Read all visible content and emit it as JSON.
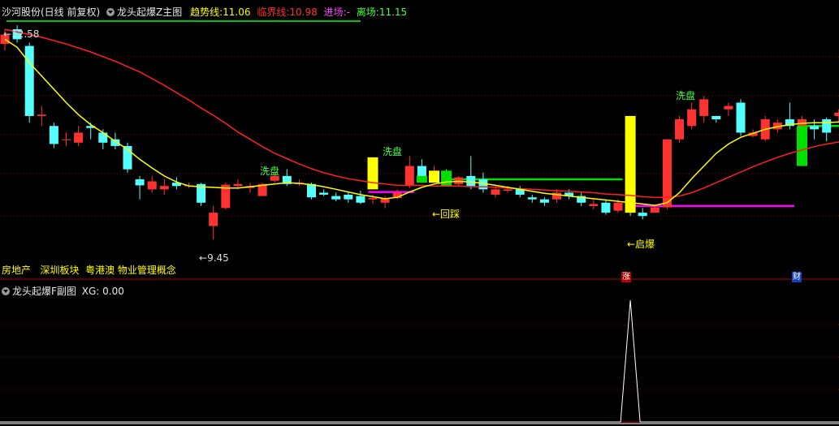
{
  "header": {
    "stock_title": "沙河股份(日线 前复权)",
    "indicator_name": "龙头起爆Z主图",
    "trend_label": "趋势线:",
    "trend_value": "11.06",
    "critical_label": "临界线:",
    "critical_value": "10.98",
    "entry_label": "进场:",
    "entry_value": "-",
    "exit_label": "离场:",
    "exit_value": "11.15"
  },
  "concepts": "房地产   深圳板块  粤港澳 物业管理概念",
  "annotations": {
    "high_price": "12.58",
    "low_price": "9.45",
    "wash1": "洗盘",
    "wash2": "洗盘",
    "wash3": "洗盘",
    "pullback": "←回踩",
    "burst": "←启爆"
  },
  "markers": {
    "limit_up": "涨",
    "finance": "财"
  },
  "sub_header": {
    "name": "龙头起爆F副图",
    "xg_label": "XG:",
    "xg_value": "0.00"
  },
  "colors": {
    "up": "#ff3232",
    "down": "#54ffff",
    "trend": "#ffff00",
    "critical": "#ff2020",
    "signal_yellow": "#ffff00",
    "signal_green": "#00e000",
    "magenta": "#ff00ff",
    "grid": "#8a0000"
  },
  "chart_data": {
    "type": "candlestick",
    "candles": [
      [
        12.38,
        12.52,
        12.6,
        12.28
      ],
      [
        12.6,
        12.45,
        12.66,
        12.4
      ],
      [
        12.35,
        11.3,
        12.4,
        11.2
      ],
      [
        11.3,
        11.32,
        11.45,
        11.15
      ],
      [
        11.15,
        10.88,
        11.2,
        10.82
      ],
      [
        10.95,
        10.95,
        11.05,
        10.85
      ],
      [
        10.9,
        11.05,
        11.15,
        10.85
      ],
      [
        11.15,
        11.12,
        11.2,
        10.95
      ],
      [
        11.05,
        10.9,
        11.1,
        10.8
      ],
      [
        10.95,
        10.85,
        11.05,
        10.8
      ],
      [
        10.85,
        10.5,
        10.9,
        10.45
      ],
      [
        10.35,
        10.26,
        10.4,
        10.05
      ],
      [
        10.2,
        10.32,
        10.4,
        10.15
      ],
      [
        10.2,
        10.25,
        10.35,
        10.12
      ],
      [
        10.3,
        10.25,
        10.38,
        10.2
      ],
      [
        10.25,
        10.26,
        10.3,
        10.22
      ],
      [
        10.28,
        10.0,
        10.3,
        9.95
      ],
      [
        9.65,
        9.85,
        9.95,
        9.45
      ],
      [
        9.92,
        10.27,
        10.3,
        9.9
      ],
      [
        10.25,
        10.28,
        10.35,
        10.2
      ],
      [
        10.22,
        10.25,
        10.3,
        10.15
      ],
      [
        10.1,
        10.28,
        10.3,
        10.1
      ],
      [
        10.33,
        10.4,
        10.45,
        10.3
      ],
      [
        10.4,
        10.28,
        10.5,
        10.25
      ],
      [
        10.28,
        10.3,
        10.35,
        10.25
      ],
      [
        10.28,
        10.08,
        10.3,
        10.05
      ],
      [
        10.15,
        10.12,
        10.2,
        10.1
      ],
      [
        10.1,
        10.05,
        10.15,
        10.02
      ],
      [
        10.12,
        10.05,
        10.15,
        10.0
      ],
      [
        10.1,
        10.0,
        10.18,
        9.98
      ],
      [
        10.05,
        10.07,
        10.12,
        9.98
      ],
      [
        10.0,
        10.06,
        10.1,
        9.92
      ],
      [
        10.07,
        10.15,
        10.2,
        10.05
      ],
      [
        10.25,
        10.55,
        10.7,
        10.22
      ],
      [
        10.55,
        10.38,
        10.65,
        10.3
      ],
      [
        10.35,
        10.46,
        10.55,
        10.3
      ],
      [
        10.44,
        10.4,
        10.5,
        10.35
      ],
      [
        10.28,
        10.38,
        10.4,
        10.25
      ],
      [
        10.4,
        10.25,
        10.7,
        10.2
      ],
      [
        10.35,
        10.2,
        10.45,
        10.15
      ],
      [
        10.12,
        10.2,
        10.25,
        10.08
      ],
      [
        10.18,
        10.2,
        10.25,
        10.15
      ],
      [
        10.2,
        10.12,
        10.25,
        10.08
      ],
      [
        10.08,
        10.05,
        10.12,
        10.0
      ],
      [
        10.05,
        10.0,
        10.08,
        9.95
      ],
      [
        10.05,
        10.15,
        10.2,
        10.0
      ],
      [
        10.15,
        10.1,
        10.2,
        10.05
      ],
      [
        10.1,
        10.0,
        10.15,
        9.95
      ],
      [
        9.95,
        9.98,
        10.05,
        9.9
      ],
      [
        10.0,
        9.85,
        10.05,
        9.82
      ],
      [
        9.88,
        10.0,
        10.05,
        9.85
      ],
      [
        10.05,
        9.85,
        10.1,
        9.8
      ],
      [
        9.85,
        9.8,
        9.92,
        9.75
      ],
      [
        9.85,
        9.93,
        9.95,
        9.85
      ],
      [
        9.93,
        10.95,
        10.95,
        9.9
      ],
      [
        10.95,
        11.25,
        11.3,
        10.9
      ],
      [
        11.15,
        11.4,
        11.5,
        11.1
      ],
      [
        11.3,
        11.55,
        11.6,
        11.2
      ],
      [
        11.3,
        11.25,
        11.3,
        11.2
      ],
      [
        11.4,
        11.45,
        11.5,
        11.3
      ],
      [
        11.5,
        11.05,
        11.55,
        11.0
      ],
      [
        11.0,
        11.05,
        11.1,
        10.98
      ],
      [
        10.95,
        11.25,
        11.3,
        10.92
      ],
      [
        11.1,
        11.2,
        11.25,
        11.05
      ],
      [
        11.25,
        11.15,
        11.5,
        11.1
      ],
      [
        11.15,
        11.25,
        11.3,
        11.0
      ],
      [
        11.15,
        11.1,
        11.25,
        10.95
      ],
      [
        11.25,
        11.05,
        11.28,
        10.92
      ],
      [
        11.3,
        11.35,
        11.4,
        11.2
      ],
      [
        11.3,
        11.2,
        11.4,
        11.15
      ],
      [
        11.2,
        11.15,
        11.25,
        11.1
      ],
      [
        11.02,
        10.75,
        11.15,
        10.65
      ],
      [
        10.85,
        10.65,
        11.0,
        10.55
      ]
    ],
    "trend_line": [
      12.45,
      12.33,
      12.1,
      11.9,
      11.7,
      11.5,
      11.32,
      11.17,
      11.05,
      10.92,
      10.8,
      10.65,
      10.52,
      10.4,
      10.31,
      10.25,
      10.24,
      10.23,
      10.22,
      10.22,
      10.24,
      10.26,
      10.28,
      10.3,
      10.29,
      10.27,
      10.24,
      10.2,
      10.16,
      10.12,
      10.09,
      10.06,
      10.08,
      10.16,
      10.23,
      10.28,
      10.31,
      10.32,
      10.31,
      10.29,
      10.26,
      10.23,
      10.2,
      10.17,
      10.14,
      10.12,
      10.1,
      10.08,
      10.06,
      10.04,
      10.02,
      10.0,
      9.98,
      9.96,
      10.0,
      10.15,
      10.36,
      10.55,
      10.74,
      10.88,
      10.98,
      11.04,
      11.1,
      11.14,
      11.17,
      11.19,
      11.2,
      11.2,
      11.21,
      11.18,
      11.14,
      11.1,
      11.06
    ],
    "critical_line": [
      12.6,
      12.56,
      12.52,
      12.48,
      12.43,
      12.38,
      12.32,
      12.26,
      12.19,
      12.12,
      12.04,
      11.96,
      11.86,
      11.76,
      11.65,
      11.54,
      11.42,
      11.31,
      11.19,
      11.06,
      10.95,
      10.84,
      10.74,
      10.66,
      10.58,
      10.51,
      10.45,
      10.4,
      10.36,
      10.33,
      10.3,
      10.28,
      10.26,
      10.26,
      10.26,
      10.25,
      10.25,
      10.25,
      10.24,
      10.24,
      10.23,
      10.22,
      10.21,
      10.2,
      10.19,
      10.18,
      10.17,
      10.16,
      10.15,
      10.13,
      10.12,
      10.11,
      10.09,
      10.08,
      10.08,
      10.1,
      10.15,
      10.22,
      10.3,
      10.38,
      10.46,
      10.54,
      10.61,
      10.68,
      10.74,
      10.79,
      10.84,
      10.88,
      10.91,
      10.94,
      10.96,
      10.98,
      10.98
    ],
    "signal_bars": [
      {
        "type": "yellow",
        "index": 30,
        "low": 10.2,
        "high": 10.68
      },
      {
        "type": "yellow",
        "index": 35,
        "low": 10.3,
        "high": 10.48
      },
      {
        "type": "green",
        "index": 34,
        "low": 10.3,
        "high": 10.4
      },
      {
        "type": "green",
        "index": 36,
        "low": 10.24,
        "high": 10.48
      },
      {
        "type": "yellow",
        "index": 51,
        "low": 9.85,
        "high": 11.3
      },
      {
        "type": "green",
        "index": 65,
        "low": 10.55,
        "high": 11.15
      }
    ],
    "level_lines": [
      {
        "color": "green",
        "from": 36,
        "to": 50,
        "value": 10.35
      },
      {
        "color": "green",
        "from": 65,
        "to": 68,
        "value": 11.15
      },
      {
        "color": "magenta",
        "from": 30,
        "to": 33,
        "value": 10.16
      },
      {
        "color": "magenta",
        "from": 51,
        "to": 64,
        "value": 9.95
      }
    ],
    "sub_chart": {
      "name": "XG",
      "values": [
        0,
        0,
        0,
        0,
        0,
        0,
        0,
        0,
        0,
        0,
        0,
        0,
        0,
        0,
        0,
        0,
        0,
        0,
        0,
        0,
        0,
        0,
        0,
        0,
        0,
        0,
        0,
        0,
        0,
        0,
        0,
        0,
        0,
        0,
        0,
        0,
        0,
        0,
        0,
        0,
        0,
        0,
        0,
        0,
        0,
        0,
        0,
        0,
        0,
        0,
        0,
        1,
        0,
        0,
        0,
        0,
        0,
        0,
        0,
        0,
        0,
        0,
        0,
        0,
        0,
        0,
        0,
        0,
        0,
        0,
        0,
        0,
        0
      ]
    }
  }
}
